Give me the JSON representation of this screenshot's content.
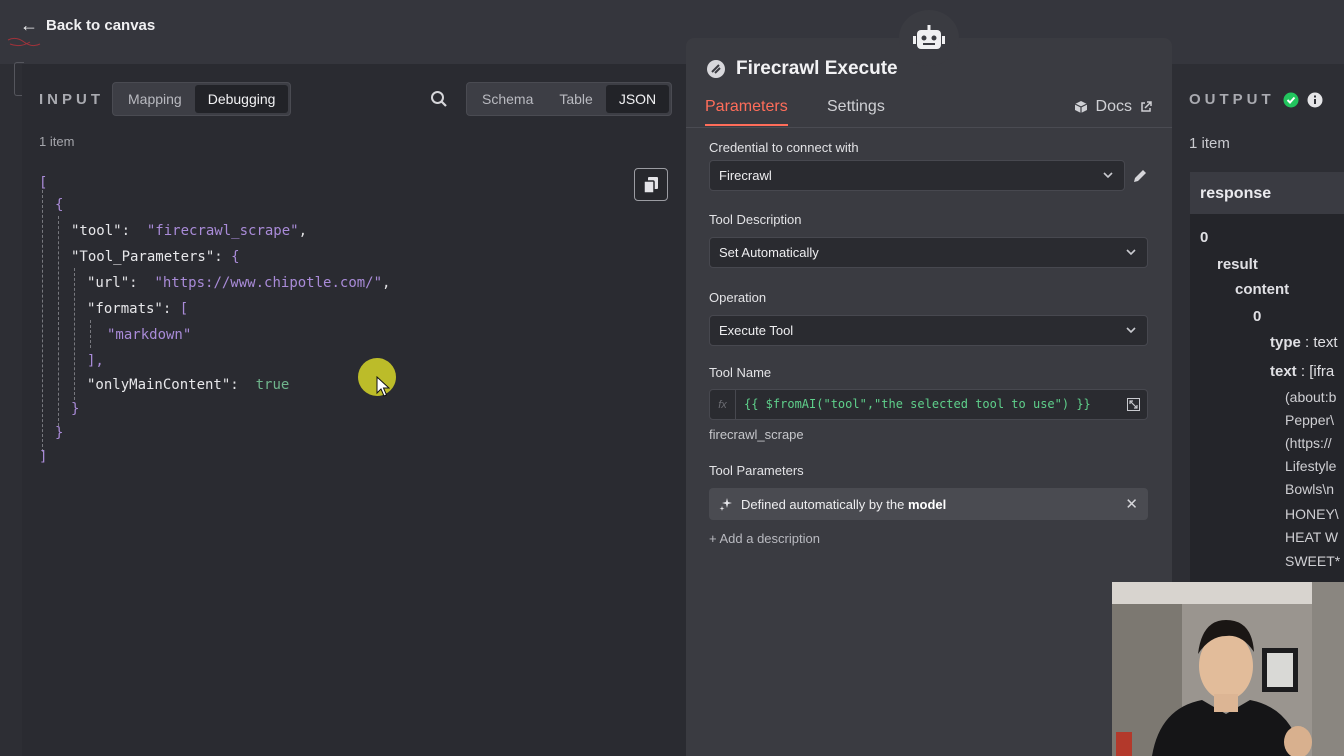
{
  "topbar": {
    "back_label": "Back to canvas"
  },
  "input": {
    "label": "INPUT",
    "mode_tabs": [
      "Mapping",
      "Debugging"
    ],
    "view_tabs": [
      "Schema",
      "Table",
      "JSON"
    ],
    "items_count": "1 item",
    "json": {
      "open_array": "[",
      "open_obj": "{",
      "tool_key": "\"tool\"",
      "tool_value": "\"firecrawl_scrape\"",
      "params_key": "\"Tool_Parameters\"",
      "url_key": "\"url\"",
      "url_value": "\"https://www.chipotle.com/\"",
      "formats_key": "\"formats\"",
      "formats_item": "\"markdown\"",
      "close_formats": "],",
      "main_key": "\"onlyMainContent\"",
      "main_value": "true",
      "close_inner": "}",
      "close_obj": "}",
      "close_array": "]"
    }
  },
  "node": {
    "title": "Firecrawl Execute",
    "tabs": [
      "Parameters",
      "Settings"
    ],
    "docs_label": "Docs",
    "credential": {
      "label": "Credential to connect with",
      "value": "Firecrawl"
    },
    "tool_description": {
      "label": "Tool Description",
      "value": "Set Automatically"
    },
    "operation": {
      "label": "Operation",
      "value": "Execute Tool"
    },
    "tool_name": {
      "label": "Tool Name",
      "expression": "{{ $fromAI(\"tool\",\"the selected tool to use\") }}",
      "result": "firecrawl_scrape"
    },
    "tool_parameters": {
      "label": "Tool Parameters",
      "defined_prefix": "Defined automatically by the",
      "defined_bold": "model",
      "add_description": "+ Add a description"
    }
  },
  "output": {
    "label": "OUTPUT",
    "items_count": "1 item",
    "column_header": "response",
    "rows": {
      "index0": "0",
      "result": "result",
      "content": "content",
      "index0b": "0",
      "type_key": "type",
      "type_val": ": text",
      "text_key": "text",
      "text_val": ": [ifra",
      "lines": [
        "(about:b",
        "Pepper\\",
        "(https://",
        "Lifestyle",
        "Bowls\\n",
        "HONEY\\",
        "HEAT W",
        "SWEET*"
      ]
    }
  },
  "colors": {
    "accent": "#ff6d5a",
    "string": "#a98bd8",
    "boolean": "#6fb58c",
    "expression": "#5fd08b",
    "success": "#22c55e"
  }
}
